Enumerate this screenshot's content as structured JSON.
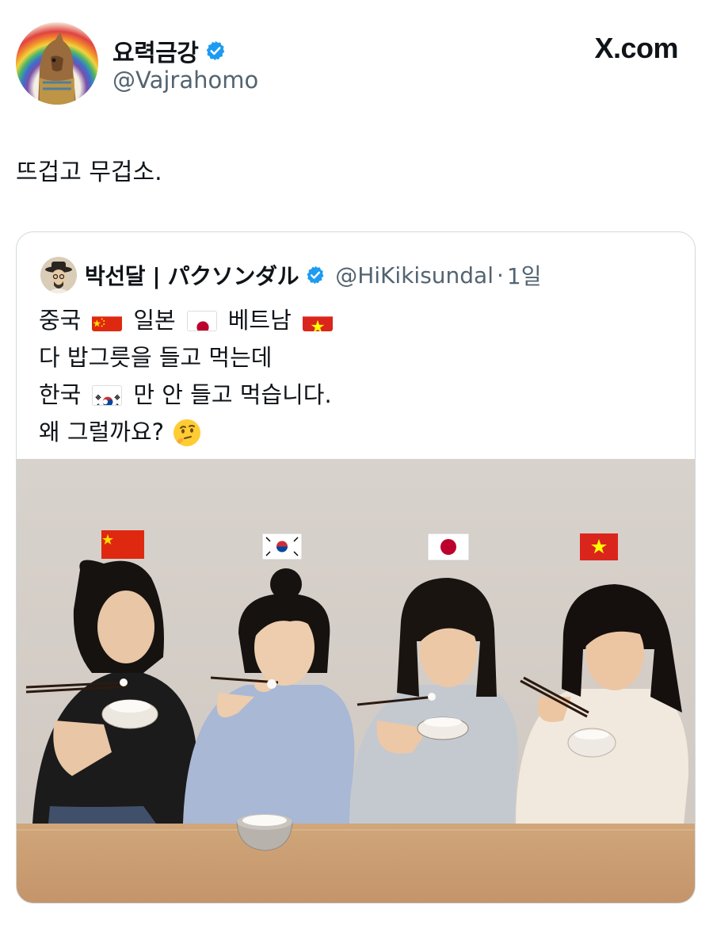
{
  "post": {
    "display_name": "요력금강",
    "handle": "@Vajrahomo",
    "verified_icon": "verified-badge-icon",
    "brand": "X.com",
    "text": "뜨겁고 무겁소."
  },
  "quoted": {
    "display_name": "박선달 | パクソンダル",
    "handle": "@HiKikisundal",
    "separator": "·",
    "time": "1일",
    "lines": [
      {
        "a": "중국",
        "b": "일본",
        "c": "베트남"
      },
      "다 밥그릇을 들고 먹는데",
      {
        "a": "한국",
        "b": "만 안 들고 먹습니다."
      },
      "왜 그럴까요?"
    ],
    "emoji": [
      "flag-china-icon",
      "flag-japan-icon",
      "flag-vietnam-icon",
      "flag-korea-icon",
      "thinking-face-icon"
    ]
  },
  "colors": {
    "verified_blue": "#1d9bf0",
    "secondary_text": "#536471",
    "border": "#cfd9de"
  }
}
